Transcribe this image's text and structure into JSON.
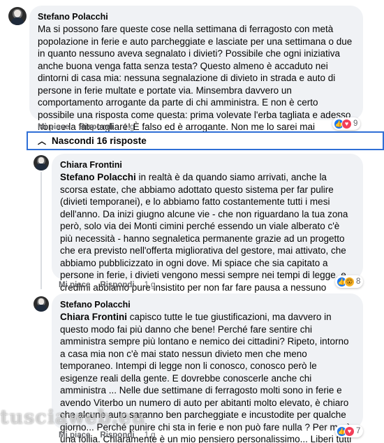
{
  "comments": [
    {
      "author": "Stefano Polacchi",
      "text": "Ma si possono fare queste cose nella settimana di ferragosto con metà popolazione in ferie e auto parcheggiate e lasciate per una settimana o due in quanto nessuno aveva segnalato i divieti? Possibile che ogni iniziativa anche buona venga fatta senza testa? Questo almeno è accaduto nei dintorni di casa mia: nessuna segnalazione di divieto in strada e auto di persone in ferie multate e portate via. Minsembra davvero un comportamento arrogante da parte di chi amministra. E non è certo possibile una risposta come questa: prima volevate l'erba tagliata e adesso non ce la fate tagliare! È falso ed è arrogante. Non me lo sarei mai aspettato!",
      "like_label": "Mi piace",
      "reply_label": "Rispondi",
      "time": "1 g",
      "reaction_count": "9",
      "reactions": [
        "like-icon",
        "love-icon"
      ]
    },
    {
      "author": "Chiara Frontini",
      "mention": "Stefano Polacchi",
      "text": " in realtà è da quando siamo arrivati, anche la scorsa estate, che abbiamo adottato questo sistema per far pulire (divieti temporanei), e lo abbiamo fatto costantemente tutti i mesi dell'anno. Da inizi giugno alcune vie - che non riguardano la tua zona però, solo via dei Monti cimini perché essendo un viale alberato c'è più necessità - hanno segnaletica permanente grazie ad un progetto che era previsto nell'offerta migliorativa del gestore, mai attivato, che abbiamo pubblicizzato in ogni dove. Mi spiace che sia capitato a persone in ferie, i divieti vengono messi sempre nei tempi di legge, e credimi abbiamo pure insistito per non far fare pausa a nessuno nemmeno ad agosto proprio per garantire efficienza e puntualità, pensa te!",
      "like_label": "Mi piace",
      "reply_label": "Rispondi",
      "time": "1 g",
      "reaction_count": "8",
      "reactions": [
        "like-icon",
        "wow-icon"
      ]
    },
    {
      "author": "Stefano Polacchi",
      "mention": "Chiara Frontini",
      "text": " capisco tutte le tue giustificazioni, ma davvero in questo modo fai più danno che bene! Perché fare sentire chi amministra sempre più lontano e nemico dei cittadini? Ripeto, intorno a casa mia non c'è mai stato nessun divieto men che meno temporaneo. Intempi di legge non li conosco, conosco però le esigenze reali della gente. E dovrebbe conoscerle anche chi amministra ... Nelle due settimane di ferragosto molti sono in ferie e avendo Viterbo un numero di auto per abitanti molto elevato, è chiaro che alcune auto saranno ben parcheggiate e incustodite per qualche giorno... Perché punire chi sta in ferie e non può fare nulla ? Per me è una follia. Chiaramente è un mio pensiero personalissimo... Liberi tutti di pensarla diversamente. Spero solo che chi amministra rifletta ...",
      "like_label": "Mi piace",
      "reply_label": "Rispondi",
      "time": "1 g",
      "reaction_count": "7",
      "reactions": [
        "like-icon",
        "love-icon"
      ]
    }
  ],
  "replies_toggle": {
    "label": "Nascondi 16 risposte"
  },
  "watermark": "tusciaweb.eu",
  "colors": {
    "like": "#1877f2",
    "love": "#f33e58",
    "wow": "#f7b125",
    "toggle_border": "#2f6fd6"
  }
}
